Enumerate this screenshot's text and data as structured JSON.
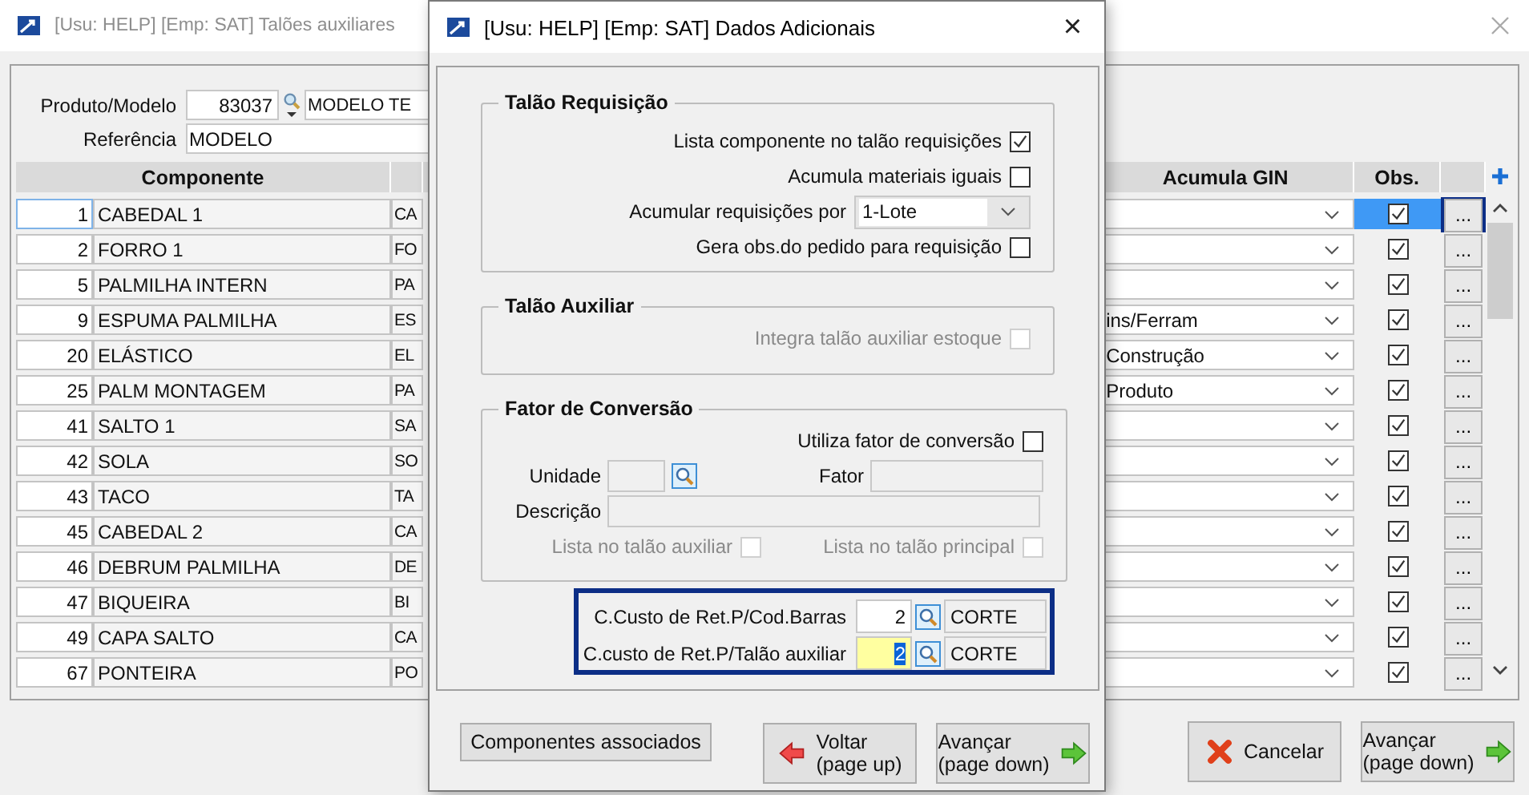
{
  "main_window": {
    "title": "[Usu: HELP] [Emp: SAT] Talões auxiliares",
    "produto_label": "Produto/Modelo",
    "produto_code": "83037",
    "produto_name": "MODELO TE",
    "referencia_label": "Referência",
    "referencia": "MODELO",
    "table": {
      "columns": {
        "componente": "Componente",
        "acumula_gin": "Acumula GIN",
        "obs": "Obs."
      },
      "rows": [
        {
          "number": "1",
          "name": "CABEDAL 1",
          "column_3": "CA",
          "details": "...",
          "obs": true,
          "selected": true,
          "focused": true
        },
        {
          "number": "2",
          "name": "FORRO 1",
          "column_3": "FO",
          "details": "...",
          "obs": true,
          "selected": false,
          "focused": false
        },
        {
          "number": "5",
          "name": "PALMILHA INTERN",
          "column_3": "PA",
          "details": "...",
          "obs": true,
          "selected": false,
          "focused": false
        },
        {
          "number": "9",
          "name": "ESPUMA PALMILHA",
          "column_3": "ES",
          "acumula_gin": "ins/Ferram",
          "details": "...",
          "obs": true,
          "selected": false,
          "focused": false
        },
        {
          "number": "20",
          "name": "ELÁSTICO",
          "column_3": "EL",
          "acumula_gin": "Construção",
          "details": "...",
          "obs": true,
          "selected": false,
          "focused": false
        },
        {
          "number": "25",
          "name": "PALM MONTAGEM",
          "column_3": "PA",
          "acumula_gin": "Produto",
          "details": "...",
          "obs": true,
          "selected": false,
          "focused": false
        },
        {
          "number": "41",
          "name": "SALTO 1",
          "column_3": "SA",
          "details": "...",
          "obs": true,
          "selected": false,
          "focused": false
        },
        {
          "number": "42",
          "name": "SOLA",
          "column_3": "SO",
          "details": "...",
          "obs": true,
          "selected": false,
          "focused": false
        },
        {
          "number": "43",
          "name": "TACO",
          "column_3": "TA",
          "details": "...",
          "obs": true,
          "selected": false,
          "focused": false
        },
        {
          "number": "45",
          "name": "CABEDAL 2",
          "column_3": "CA",
          "details": "...",
          "obs": true,
          "selected": false,
          "focused": false
        },
        {
          "number": "46",
          "name": "DEBRUM PALMILHA",
          "column_3": "DE",
          "details": "...",
          "obs": true,
          "selected": false,
          "focused": false
        },
        {
          "number": "47",
          "name": "BIQUEIRA",
          "column_3": "BI",
          "details": "...",
          "obs": true,
          "selected": false,
          "focused": false
        },
        {
          "number": "49",
          "name": "CAPA SALTO",
          "column_3": "CA",
          "details": "...",
          "obs": true,
          "selected": false,
          "focused": false
        },
        {
          "number": "67",
          "name": "PONTEIRA",
          "column_3": "PO",
          "details": "...",
          "obs": true,
          "selected": false,
          "focused": false
        }
      ]
    },
    "buttons": [
      {
        "kind": "cancel",
        "label": "Cancelar"
      },
      {
        "kind": "next",
        "label": "Avançar",
        "hint": "(page down)"
      }
    ]
  },
  "dialog": {
    "title": "[Usu: HELP] [Emp: SAT] Dados Adicionais",
    "close": "×",
    "talao_requisicao": {
      "title": "Talão Requisição",
      "items": [
        {
          "kind": "checkbox",
          "label": "Lista componente no talão requisições",
          "checked": true,
          "disabled": false
        },
        {
          "kind": "checkbox",
          "label": "Acumula materiais iguais",
          "checked": false,
          "disabled": false
        },
        {
          "kind": "select",
          "label": "Acumular requisições por",
          "value": "1-Lote"
        },
        {
          "kind": "checkbox",
          "label": "Gera obs.do pedido para requisição",
          "checked": false,
          "disabled": false
        }
      ]
    },
    "talao_auxiliar": {
      "title": "Talão Auxiliar",
      "items": [
        {
          "kind": "checkbox",
          "label": "Integra talão auxiliar estoque",
          "checked": false,
          "disabled": true
        }
      ]
    },
    "fator": {
      "title": "Fator de Conversão",
      "utiliza": {
        "label": "Utiliza fator de conversão",
        "checked": false,
        "disabled": false
      },
      "unidade_label": "Unidade",
      "fator_label": "Fator",
      "descricao_label": "Descrição",
      "lista_auxiliar": {
        "label": "Lista no talão auxiliar",
        "checked": false,
        "disabled": true
      },
      "lista_principal": {
        "label": "Lista no talão principal",
        "checked": false,
        "disabled": true
      }
    },
    "custos": [
      {
        "label": "C.Custo de Ret.P/Cod.Barras",
        "code": "2",
        "name": "CORTE",
        "active": false
      },
      {
        "label": "C.custo de Ret.P/Talão auxiliar",
        "code": "2",
        "name": "CORTE",
        "active": true
      }
    ],
    "buttons": [
      {
        "kind": "plain",
        "label": "Componentes associados"
      },
      {
        "kind": "back",
        "label": "Voltar",
        "hint": "(page up)"
      },
      {
        "kind": "next",
        "label": "Avançar",
        "hint": "(page down)"
      }
    ]
  }
}
